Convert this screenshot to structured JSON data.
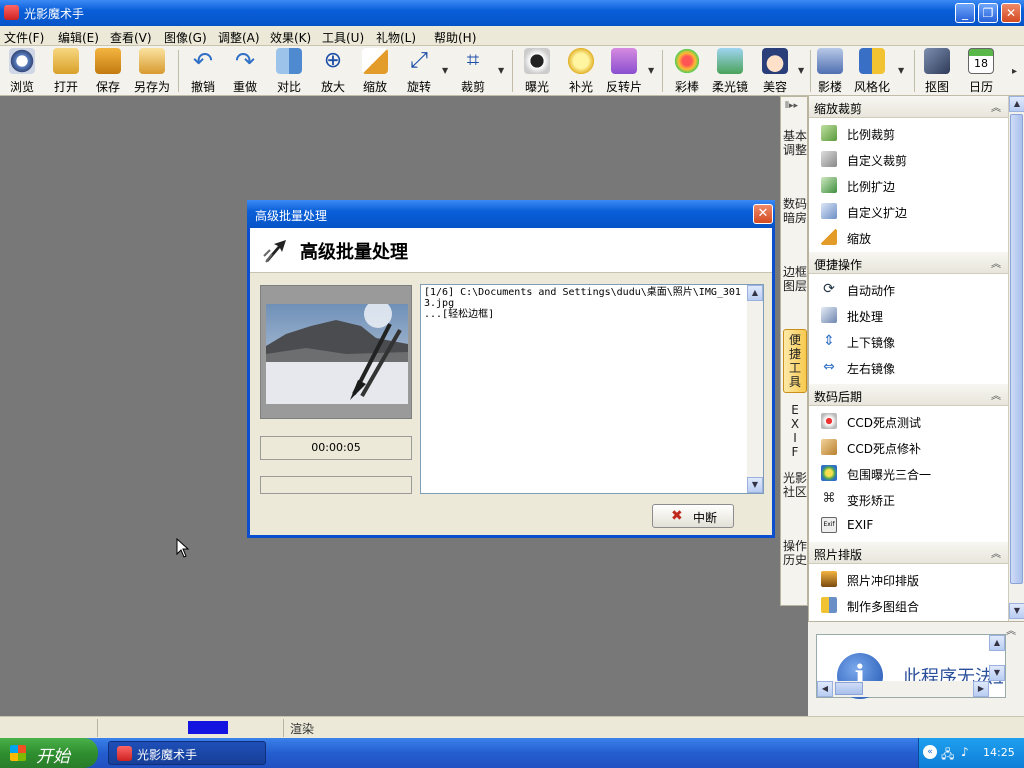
{
  "window": {
    "title": "光影魔术手"
  },
  "menu": [
    "文件(F)",
    "编辑(E)",
    "查看(V)",
    "图像(G)",
    "调整(A)",
    "效果(K)",
    "工具(U)",
    "礼物(L)",
    "帮助(H)"
  ],
  "toolbar": [
    "浏览",
    "打开",
    "保存",
    "另存为",
    "撤销",
    "重做",
    "对比",
    "放大",
    "缩放",
    "旋转",
    "裁剪",
    "曝光",
    "补光",
    "反转片",
    "彩棒",
    "柔光镜",
    "美容",
    "影楼",
    "风格化",
    "抠图",
    "日历"
  ],
  "toolbar_calendar_day": "18",
  "vtabs": [
    "基本调整",
    "数码暗房",
    "边框图层",
    "便捷工具",
    "EXIF",
    "光影社区",
    "操作历史"
  ],
  "vtabs_active": "便捷工具",
  "panel": {
    "sections": [
      {
        "title": "缩放裁剪",
        "items": [
          "比例裁剪",
          "自定义裁剪",
          "比例扩边",
          "自定义扩边",
          "缩放"
        ]
      },
      {
        "title": "便捷操作",
        "items": [
          "自动动作",
          "批处理",
          "上下镜像",
          "左右镜像"
        ]
      },
      {
        "title": "数码后期",
        "items": [
          "CCD死点测试",
          "CCD死点修补",
          "包围曝光三合一",
          "变形矫正",
          "EXIF"
        ]
      },
      {
        "title": "照片排版",
        "items": [
          "照片冲印排版",
          "制作多图组合"
        ]
      }
    ],
    "preview_text": "此程序无法显示"
  },
  "dialog": {
    "title": "高级批量处理",
    "heading": "高级批量处理",
    "log": "[1/6] C:\\Documents and Settings\\dudu\\桌面\\照片\\IMG_3013.jpg\n...[轻松边框]",
    "elapsed": "00:00:05",
    "stop_label": "中断"
  },
  "status": {
    "text": "渲染"
  },
  "taskbar": {
    "start": "开始",
    "task": "光影魔术手",
    "clock": "14:25"
  },
  "colors": {
    "accent": "#0a5fd8",
    "progress": "#1414e0"
  }
}
